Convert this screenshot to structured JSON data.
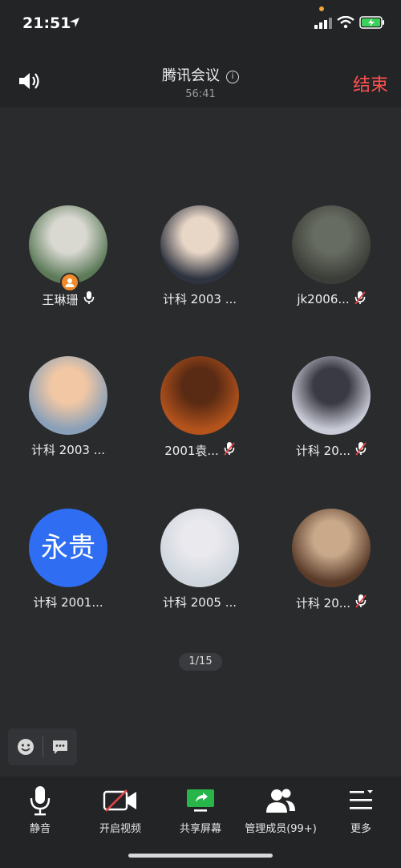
{
  "status": {
    "time": "21:51"
  },
  "header": {
    "title": "腾讯会议",
    "timer": "56:41",
    "end_label": "结束"
  },
  "participants": [
    {
      "name": "王琳珊",
      "mic": "on",
      "host": true,
      "colors": [
        "#5c7a58",
        "#d9d9d2"
      ]
    },
    {
      "name": "计科 2003 ...",
      "mic": "none",
      "host": false,
      "colors": [
        "#2e3340",
        "#e8d6c6"
      ]
    },
    {
      "name": "jk2006...",
      "mic": "muted",
      "host": false,
      "colors": [
        "#3b3e38",
        "#676c62"
      ]
    },
    {
      "name": "计科 2003 ...",
      "mic": "none",
      "host": false,
      "colors": [
        "#8aa0b8",
        "#f1c7a4"
      ]
    },
    {
      "name": "2001袁...",
      "mic": "muted",
      "host": false,
      "colors": [
        "#b4531c",
        "#5a2b14"
      ]
    },
    {
      "name": "计科 20...",
      "mic": "muted",
      "host": false,
      "colors": [
        "#c9cbd6",
        "#3a3a44"
      ]
    },
    {
      "name": "计科 2001...",
      "mic": "none",
      "host": false,
      "initials": "永贵",
      "colors": [
        "#2f6ef2",
        "#2f6ef2"
      ]
    },
    {
      "name": "计科 2005 ...",
      "mic": "none",
      "host": false,
      "colors": [
        "#cfd6dd",
        "#e9e9ee"
      ]
    },
    {
      "name": "计科 20...",
      "mic": "muted",
      "host": false,
      "colors": [
        "#5a3b2a",
        "#c9a98a"
      ]
    }
  ],
  "pager": {
    "text": "1/15"
  },
  "toolbar": {
    "mute_label": "静音",
    "video_label": "开启视频",
    "share_label": "共享屏幕",
    "members_label": "管理成员(99+)",
    "more_label": "更多"
  }
}
